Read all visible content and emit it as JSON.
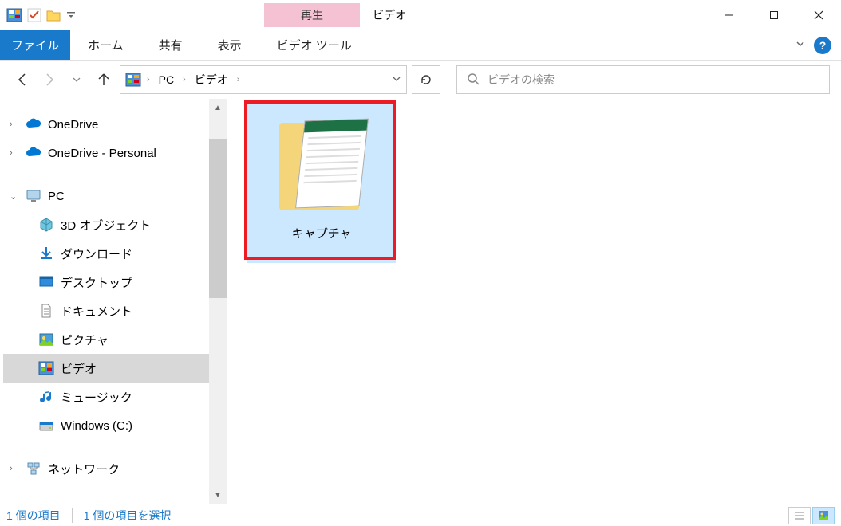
{
  "window": {
    "title": "ビデオ",
    "contextual_tab_label": "再生"
  },
  "ribbon": {
    "file": "ファイル",
    "tabs": [
      "ホーム",
      "共有",
      "表示"
    ],
    "contextual_tab": "ビデオ ツール"
  },
  "breadcrumbs": [
    "PC",
    "ビデオ"
  ],
  "search": {
    "placeholder": "ビデオの検索"
  },
  "tree": {
    "items": [
      {
        "label": "OneDrive",
        "icon": "onedrive",
        "level": 0
      },
      {
        "label": "OneDrive - Personal",
        "icon": "onedrive",
        "level": 0
      },
      {
        "spacer": true
      },
      {
        "label": "PC",
        "icon": "pc",
        "level": 0,
        "expanded": true
      },
      {
        "label": "3D オブジェクト",
        "icon": "3d",
        "level": 1
      },
      {
        "label": "ダウンロード",
        "icon": "download",
        "level": 1
      },
      {
        "label": "デスクトップ",
        "icon": "desktop",
        "level": 1
      },
      {
        "label": "ドキュメント",
        "icon": "document",
        "level": 1
      },
      {
        "label": "ピクチャ",
        "icon": "picture",
        "level": 1
      },
      {
        "label": "ビデオ",
        "icon": "video",
        "level": 1,
        "selected": true
      },
      {
        "label": "ミュージック",
        "icon": "music",
        "level": 1
      },
      {
        "label": "Windows (C:)",
        "icon": "disk",
        "level": 1
      },
      {
        "spacer": true
      },
      {
        "label": "ネットワーク",
        "icon": "network",
        "level": 0
      }
    ]
  },
  "content": {
    "items": [
      {
        "name": "キャプチャ",
        "type": "folder",
        "selected": true,
        "highlighted": true
      }
    ]
  },
  "statusbar": {
    "count_text": "1 個の項目",
    "selection_text": "1 個の項目を選択"
  }
}
